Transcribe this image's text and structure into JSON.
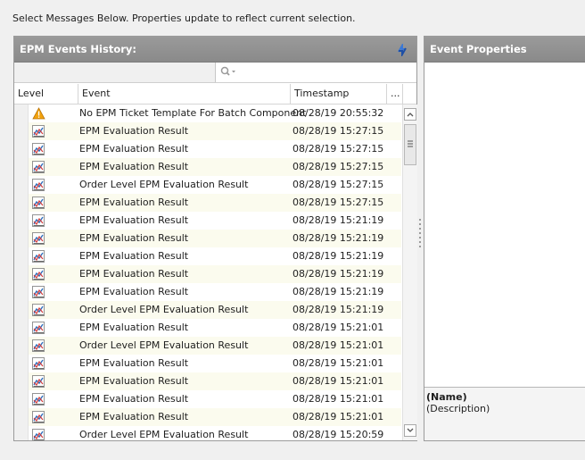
{
  "instructions": "Select Messages Below.  Properties update to reflect current selection.",
  "events_panel": {
    "title": "EPM Events History:",
    "search": {
      "value": "",
      "placeholder": ""
    },
    "columns": {
      "level": "Level",
      "event": "Event",
      "timestamp": "Timestamp",
      "more": "..."
    },
    "rows": [
      {
        "level_icon": "warning-icon",
        "event": "No EPM Ticket Template For Batch Component",
        "timestamp": "08/28/19 20:55:32"
      },
      {
        "level_icon": "chart-icon",
        "event": "EPM Evaluation Result",
        "timestamp": "08/28/19 15:27:15"
      },
      {
        "level_icon": "chart-icon",
        "event": "EPM Evaluation Result",
        "timestamp": "08/28/19 15:27:15"
      },
      {
        "level_icon": "chart-icon",
        "event": "EPM Evaluation Result",
        "timestamp": "08/28/19 15:27:15"
      },
      {
        "level_icon": "chart-icon",
        "event": "Order Level EPM Evaluation Result",
        "timestamp": "08/28/19 15:27:15"
      },
      {
        "level_icon": "chart-icon",
        "event": "EPM Evaluation Result",
        "timestamp": "08/28/19 15:27:15"
      },
      {
        "level_icon": "chart-icon",
        "event": "EPM Evaluation Result",
        "timestamp": "08/28/19 15:21:19"
      },
      {
        "level_icon": "chart-icon",
        "event": "EPM Evaluation Result",
        "timestamp": "08/28/19 15:21:19"
      },
      {
        "level_icon": "chart-icon",
        "event": "EPM Evaluation Result",
        "timestamp": "08/28/19 15:21:19"
      },
      {
        "level_icon": "chart-icon",
        "event": "EPM Evaluation Result",
        "timestamp": "08/28/19 15:21:19"
      },
      {
        "level_icon": "chart-icon",
        "event": "EPM Evaluation Result",
        "timestamp": "08/28/19 15:21:19"
      },
      {
        "level_icon": "chart-icon",
        "event": "Order Level EPM Evaluation Result",
        "timestamp": "08/28/19 15:21:19"
      },
      {
        "level_icon": "chart-icon",
        "event": "EPM Evaluation Result",
        "timestamp": "08/28/19 15:21:01"
      },
      {
        "level_icon": "chart-icon",
        "event": "Order Level EPM Evaluation Result",
        "timestamp": "08/28/19 15:21:01"
      },
      {
        "level_icon": "chart-icon",
        "event": "EPM Evaluation Result",
        "timestamp": "08/28/19 15:21:01"
      },
      {
        "level_icon": "chart-icon",
        "event": "EPM Evaluation Result",
        "timestamp": "08/28/19 15:21:01"
      },
      {
        "level_icon": "chart-icon",
        "event": "EPM Evaluation Result",
        "timestamp": "08/28/19 15:21:01"
      },
      {
        "level_icon": "chart-icon",
        "event": "EPM Evaluation Result",
        "timestamp": "08/28/19 15:21:01"
      },
      {
        "level_icon": "chart-icon",
        "event": "Order Level EPM Evaluation Result",
        "timestamp": "08/28/19 15:20:59"
      }
    ]
  },
  "properties_panel": {
    "title": "Event Properties",
    "name_label": "(Name)",
    "description_label": "(Description)"
  },
  "colors": {
    "header_bg": "#8e8e8e",
    "row_alt_bg": "#fbfbee",
    "warning": "#f2a20c",
    "chart_blue": "#2e6fbf",
    "chart_red": "#d23a3a"
  }
}
